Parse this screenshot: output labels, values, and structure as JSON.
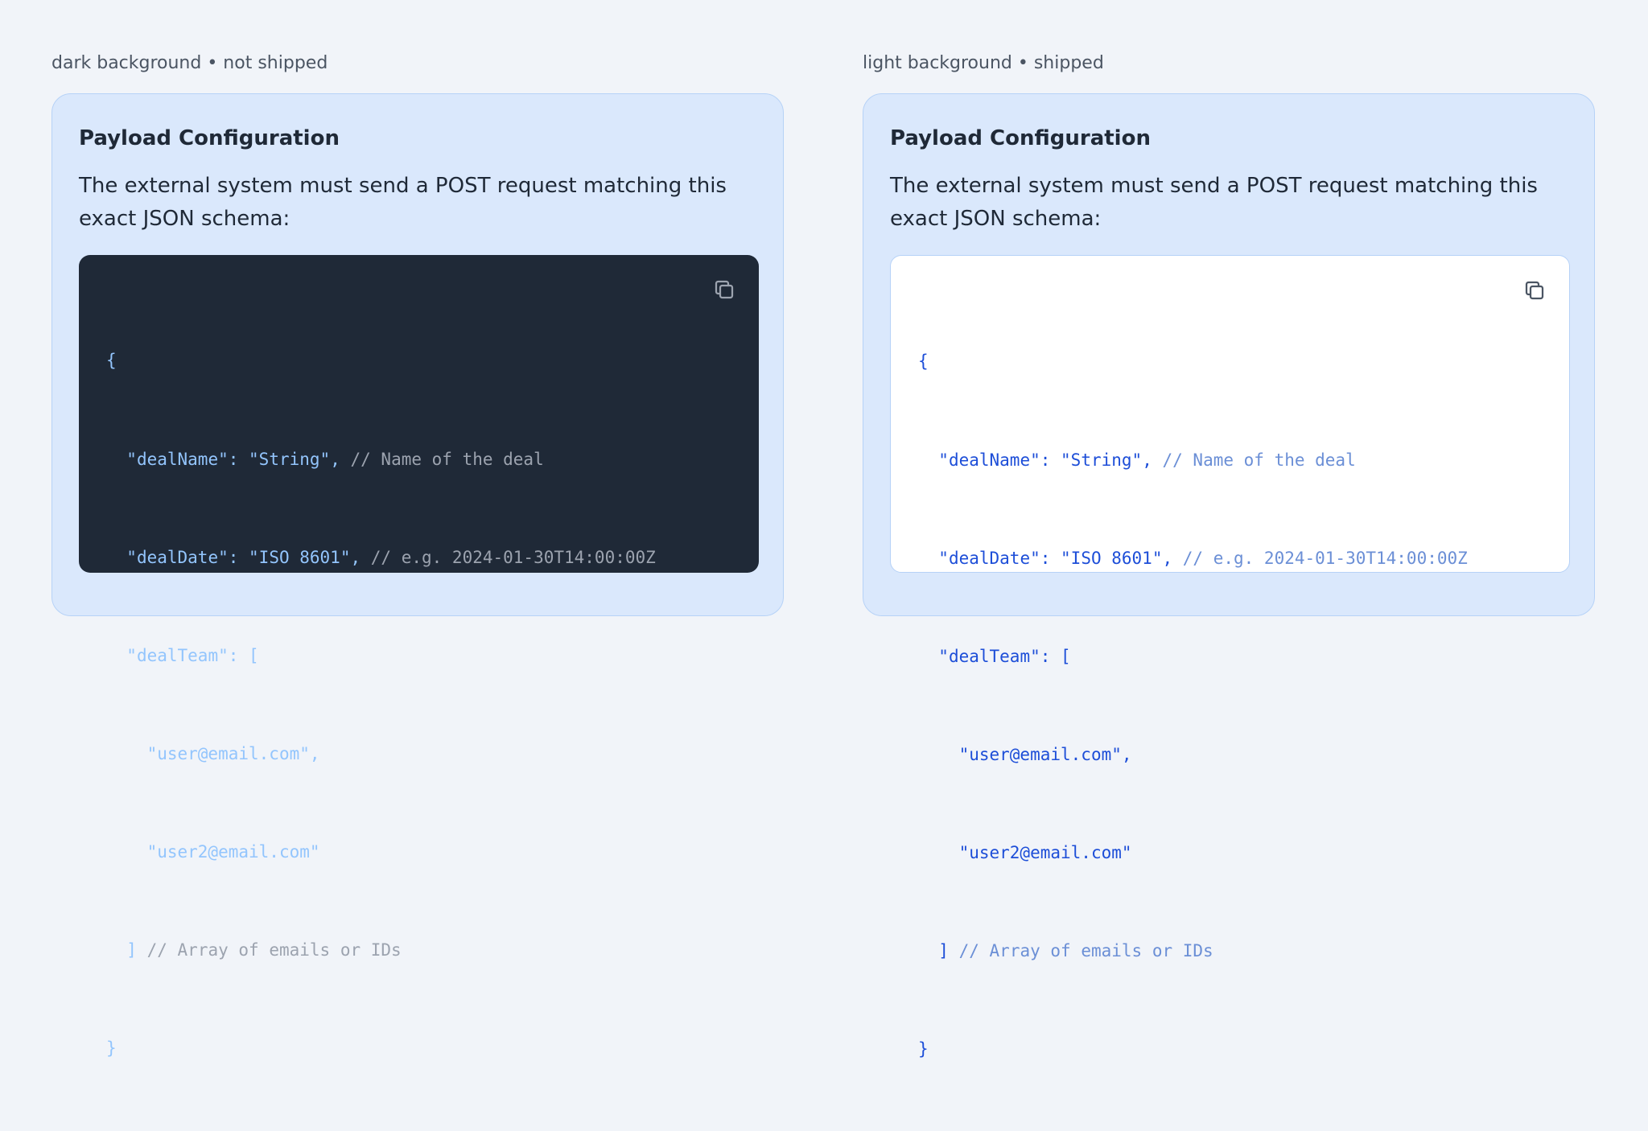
{
  "panels": [
    {
      "caption": "dark background • not shipped",
      "title": "Payload Configuration",
      "description": "The external system must send a POST request matching this exact JSON schema:",
      "theme": "dark",
      "copy_icon": "copy-icon"
    },
    {
      "caption": "light background • shipped",
      "title": "Payload Configuration",
      "description": "The external system must send a POST request matching this exact JSON schema:",
      "theme": "light",
      "copy_icon": "copy-icon"
    }
  ],
  "code": {
    "open_brace": "{",
    "close_brace": "}",
    "dealName_key": "\"dealName\"",
    "dealName_value": "\"String\"",
    "dealName_comment": "// Name of the deal",
    "dealDate_key": "\"dealDate\"",
    "dealDate_value": "\"ISO 8601\"",
    "dealDate_comment": "// e.g. 2024-01-30T14:00:00Z",
    "dealTeam_key": "\"dealTeam\"",
    "dealTeam_open": "[",
    "team_item_1": "\"user@email.com\"",
    "team_item_2": "\"user2@email.com\"",
    "dealTeam_close": "]",
    "dealTeam_comment": "// Array of emails or IDs",
    "colon": ": ",
    "comma": ","
  },
  "colors": {
    "page_bg": "#f1f4f9",
    "card_bg": "#dae8fc",
    "card_border": "#b6d2f7",
    "code_dark_bg": "#1f2937",
    "code_light_bg": "#ffffff",
    "token_dark": "#93c5fd",
    "token_light": "#1d4ed8",
    "comment_dark": "#9ca3af",
    "comment_light": "#6b8fd6"
  }
}
